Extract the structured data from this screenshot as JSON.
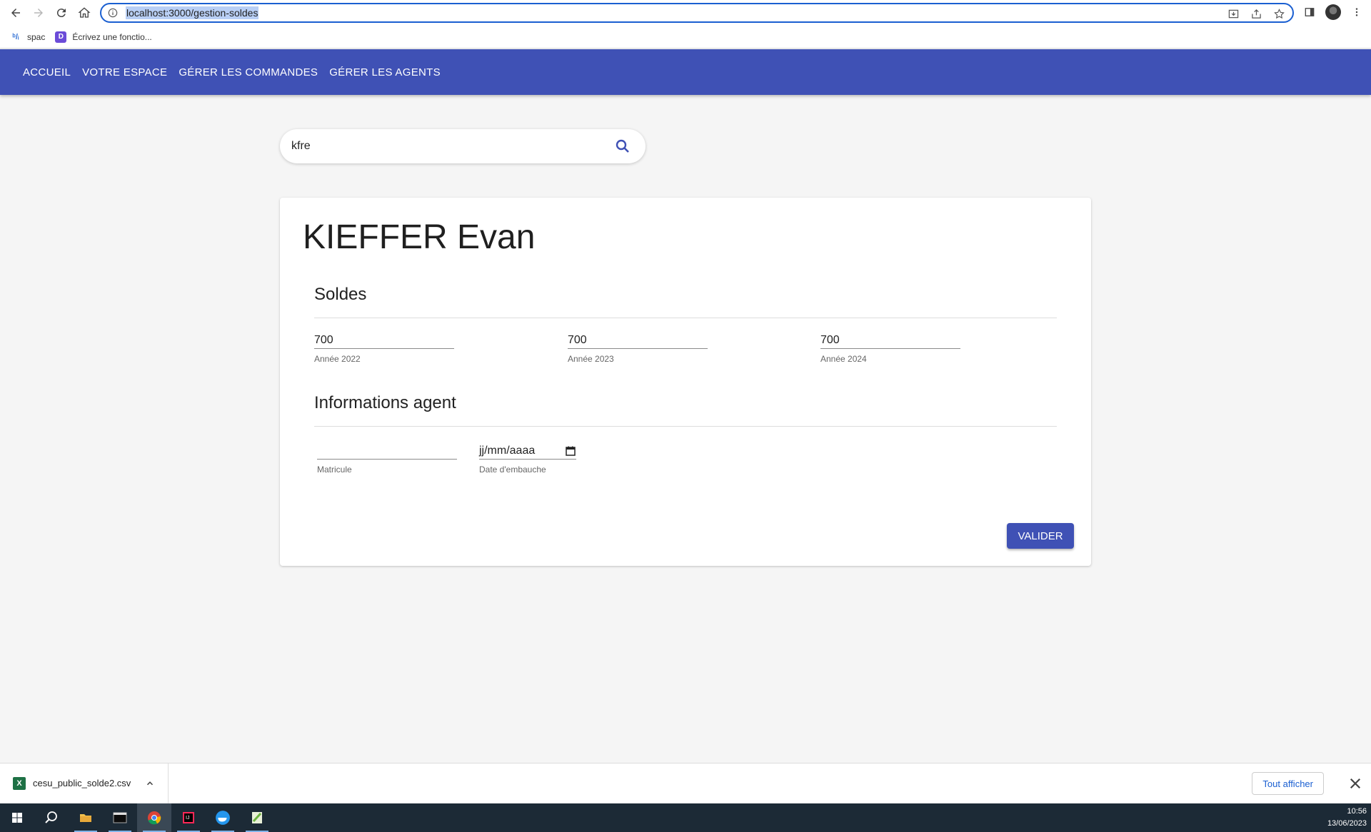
{
  "browser": {
    "url": "localhost:3000/gestion-soldes",
    "bookmarks": [
      {
        "label": "spac",
        "icon": "spac-logo-icon"
      },
      {
        "label": "Écrivez une fonctio...",
        "icon": "notion-icon"
      }
    ]
  },
  "appbar": {
    "links": [
      "ACCUEIL",
      "VOTRE ESPACE",
      "GÉRER LES COMMANDES",
      "GÉRER LES AGENTS"
    ],
    "color": "#3f51b5"
  },
  "search": {
    "value": "kfre"
  },
  "card": {
    "name": "KIEFFER Evan",
    "soldes": {
      "title": "Soldes",
      "fields": [
        {
          "value": "700",
          "label": "Année 2022"
        },
        {
          "value": "700",
          "label": "Année 2023"
        },
        {
          "value": "700",
          "label": "Année 2024"
        }
      ]
    },
    "info": {
      "title": "Informations agent",
      "matricule": {
        "value": "",
        "label": "Matricule"
      },
      "date_embauche": {
        "value": "jj/mm/aaaa",
        "label": "Date d'embauche"
      }
    },
    "submit_label": "VALIDER"
  },
  "downloads": {
    "file": "cesu_public_solde2.csv",
    "show_all": "Tout afficher"
  },
  "taskbar": {
    "time": "10:56",
    "date": "13/06/2023"
  }
}
